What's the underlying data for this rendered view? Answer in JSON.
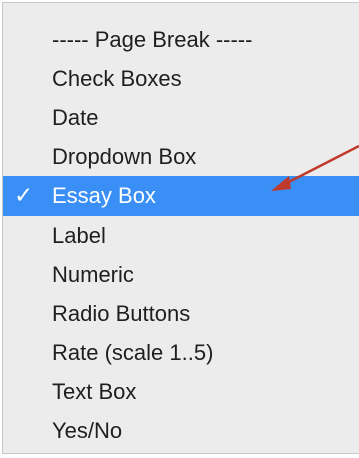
{
  "menu": {
    "items": [
      {
        "label": "----- Page Break -----"
      },
      {
        "label": "Check Boxes"
      },
      {
        "label": "Date"
      },
      {
        "label": "Dropdown Box"
      },
      {
        "label": "Essay Box",
        "selected": true,
        "check": "✓"
      },
      {
        "label": "Label"
      },
      {
        "label": "Numeric"
      },
      {
        "label": "Radio Buttons"
      },
      {
        "label": "Rate (scale 1..5)"
      },
      {
        "label": "Text Box"
      },
      {
        "label": "Yes/No"
      }
    ]
  },
  "colors": {
    "menu_background": "#ececec",
    "selection": "#3a8ff6",
    "annotation_arrow": "#c0392b"
  }
}
